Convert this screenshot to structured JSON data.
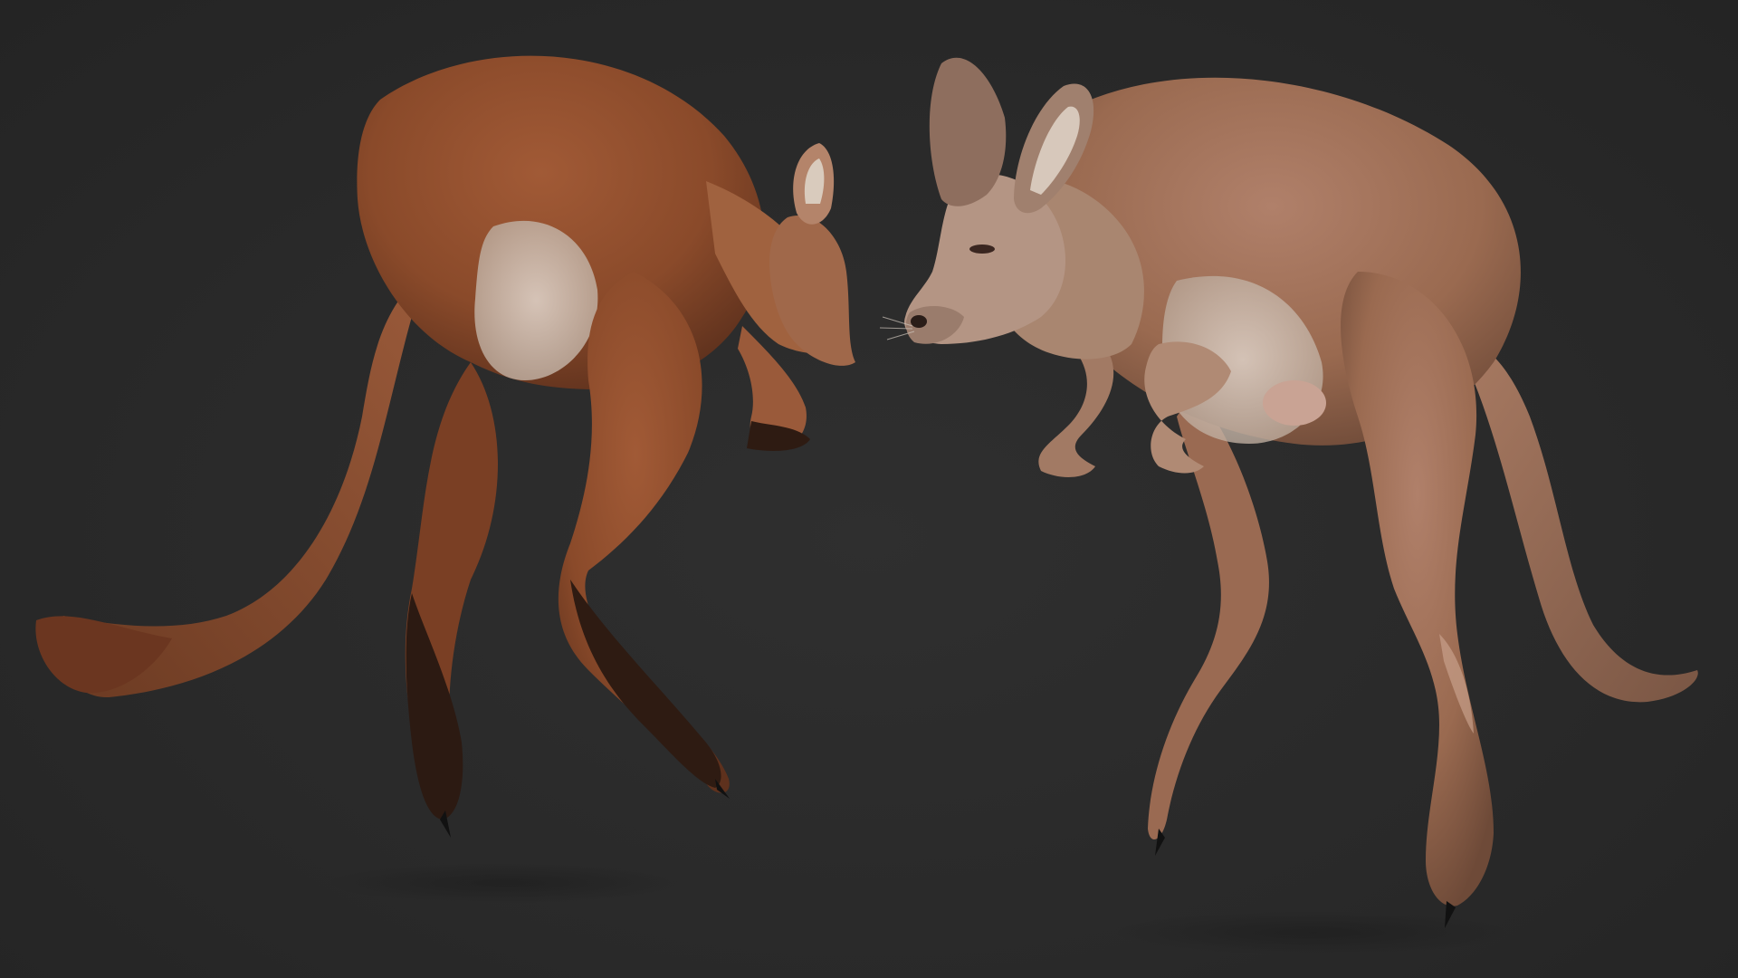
{
  "scene": {
    "subjects": [
      {
        "name": "kangaroo-left",
        "view": "rear-three-quarter",
        "fur_color": "#8a4a2a"
      },
      {
        "name": "kangaroo-right",
        "view": "front-three-quarter",
        "fur_color": "#9a6a50"
      }
    ],
    "colors": {
      "background": "#292929",
      "fur_dark": "#6e3a22",
      "fur_mid": "#9a5a3a",
      "fur_light": "#c9a28a",
      "belly": "#d8cfc6",
      "claw": "#111111"
    }
  }
}
